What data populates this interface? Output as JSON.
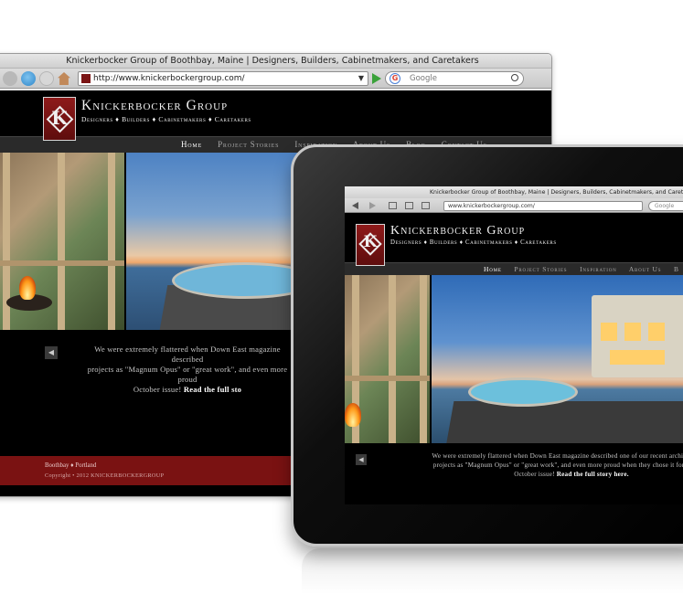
{
  "desktop": {
    "window_title": "Knickerbocker Group of Boothbay, Maine | Designers, Builders, Cabinetmakers, and Caretakers",
    "url": "http://www.knickerbockergroup.com/",
    "search_placeholder": "Google",
    "search_engine_letter": "G",
    "site": {
      "brand_name": "Knickerbocker Group",
      "tagline": "Designers ♦ Builders ♦ Cabinetmakers ♦ Caretakers",
      "logo_letter": "K",
      "nav": [
        "Home",
        "Project Stories",
        "Inspiration",
        "About Us",
        "Blog",
        "Contact Us"
      ],
      "caption_lines": [
        "We were extremely flattered when Down East magazine described",
        "projects as \"Magnum Opus\" or \"great work\", and even more proud",
        "October issue!"
      ],
      "caption_link": "Read the full sto",
      "prev_arrow": "◀",
      "footer_locations": "Boothbay ♦ Portland",
      "footer_copyright": "Copyright • 2012 KNICKERBOCKERGROUP"
    }
  },
  "tablet": {
    "window_title": "Knickerbocker Group of Boothbay, Maine | Designers, Builders, Cabinetmakers, and Caretakers",
    "url": "www.knickerbockergroup.com/",
    "search_placeholder": "Google",
    "site": {
      "brand_name": "Knickerbocker Group",
      "tagline": "Designers ♦ Builders ♦ Cabinetmakers ♦ Caretakers",
      "logo_letter": "K",
      "nav": [
        "Home",
        "Project Stories",
        "Inspiration",
        "About Us",
        "B"
      ],
      "caption_lines": [
        "We were extremely flattered when Down East magazine described one of our recent architecture/co",
        "projects as \"Magnum Opus\" or \"great work\", and even more proud when they chose it for the cove",
        "October issue!"
      ],
      "caption_link": "Read the full story here.",
      "prev_arrow": "◀"
    }
  },
  "colors": {
    "brand_red": "#7a1212",
    "site_bg": "#000000",
    "nav_bg": "#2a2a2a",
    "nav_active": "#ffffff",
    "nav_inactive": "#a8a8a8"
  }
}
